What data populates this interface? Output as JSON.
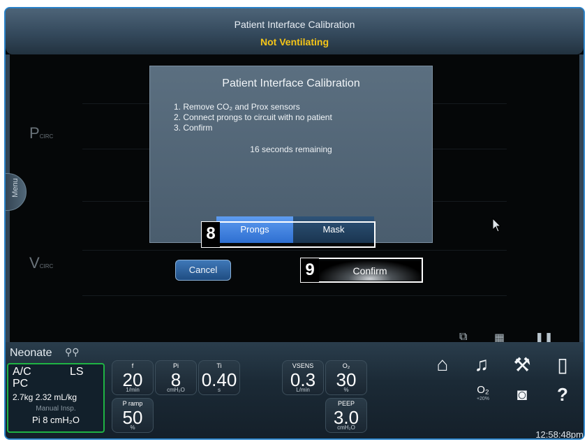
{
  "header": {
    "title": "Patient Interface Calibration",
    "status": "Not Ventilating"
  },
  "main": {
    "menu_label": "Menu",
    "wave_pressure_label": "P",
    "wave_pressure_sub": "CIRC",
    "wave_flow_label": "V",
    "wave_flow_sub": "CIRC"
  },
  "dialog": {
    "title": "Patient Interface Calibration",
    "steps": [
      "1. Remove CO₂ and Prox sensors",
      "2. Connect prongs to circuit with no patient",
      "3. Confirm"
    ],
    "countdown": "16 seconds remaining",
    "prongs_label": "Prongs",
    "mask_label": "Mask",
    "cancel_label": "Cancel",
    "confirm_label": "Confirm",
    "selected_interface": "Prongs"
  },
  "callouts": {
    "badge_8": "8",
    "badge_9": "9"
  },
  "footer": {
    "patient_type": "Neonate",
    "mode": {
      "line1_left": "A/C",
      "line1_right": "LS",
      "line2": "PC",
      "weight": "2.7kg   2.32 mL/kg",
      "manual": "Manual Insp.",
      "pi": "Pi 8 cmH₂O"
    },
    "params": [
      {
        "label": "f",
        "value": "20",
        "unit": "1/min"
      },
      {
        "label": "Pi",
        "value": "8",
        "unit": "cmH₂O"
      },
      {
        "label": "Ti",
        "value": "0.40",
        "unit": "s"
      },
      {
        "label": "VSENS",
        "value": "0.3",
        "unit": "L/min"
      },
      {
        "label": "O₂",
        "value": "30",
        "unit": "%"
      },
      {
        "label": "P ramp",
        "value": "50",
        "unit": "%"
      },
      {
        "label": "PEEP",
        "value": "3.0",
        "unit": "cmH₂O"
      }
    ],
    "o2_label": "O₂",
    "o2_sub": "+20%",
    "clock": "12:58:48pm"
  },
  "colors": {
    "accent_blue": "#2e6fd1",
    "status_yellow": "#f5c518",
    "mode_green": "#1fb344",
    "frame_border": "#2a82c8"
  },
  "icons": [
    "home-icon",
    "alarm-bell-icon",
    "wrench-icon",
    "battery-alert-icon",
    "o2-icon",
    "camera-icon",
    "help-icon",
    "cursor-icon",
    "freeze-icon",
    "grid-icon",
    "pause-icon",
    "patient-icon"
  ]
}
